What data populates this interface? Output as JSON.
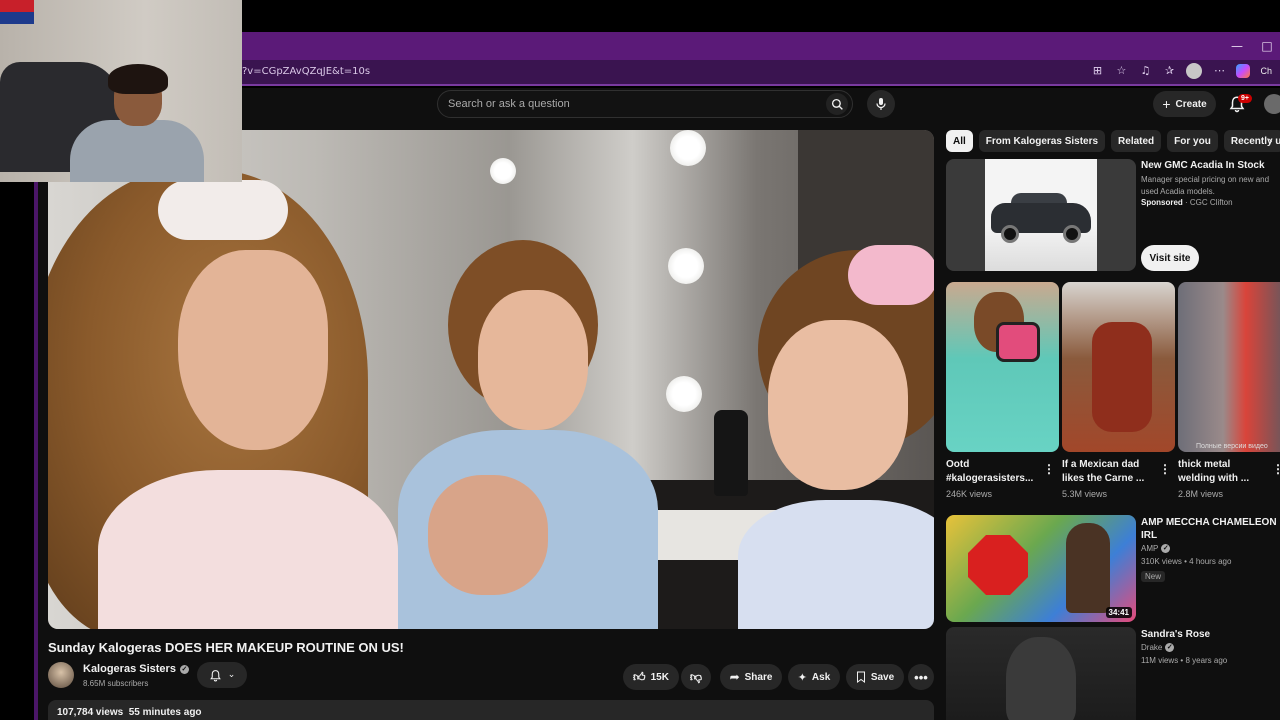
{
  "browser": {
    "url": "?v=CGpZAvQZqJE&t=10s",
    "minimize_glyph": "—",
    "maximize_glyph": "□",
    "copilot_label": "Ch"
  },
  "header": {
    "search_placeholder": "Search or ask a question",
    "create_label": "Create",
    "notification_badge": "9+"
  },
  "video": {
    "title": "Sunday Kalogeras DOES HER MAKEUP ROUTINE ON US!",
    "channel": "Kalogeras Sisters",
    "subscribers": "8.65M subscribers",
    "likes": "15K",
    "share_label": "Share",
    "ask_label": "Ask",
    "save_label": "Save",
    "views": "107,784 views",
    "posted": "55 minutes ago"
  },
  "chips": [
    "All",
    "From Kalogeras Sisters",
    "Related",
    "For you",
    "Recently u"
  ],
  "ad": {
    "title": "New GMC Acadia In Stock",
    "description": "Manager special pricing on new and used Acadia models.",
    "sponsored_label": "Sponsored",
    "advertiser": "· CGC Clifton",
    "visit_label": "Visit site"
  },
  "shorts": [
    {
      "title": "Ootd #kalogerasisters...",
      "views": "246K views"
    },
    {
      "title": "If a Mexican dad likes the Carne ...",
      "views": "5.3M views"
    },
    {
      "title": "thick metal welding with ...",
      "views": "2.8M views",
      "caption": "Полные версии видео"
    }
  ],
  "recommended": [
    {
      "title": "AMP MECCHA CHAMELEON IRL",
      "channel": "AMP",
      "meta": "310K views • 4 hours ago",
      "duration": "34:41",
      "badge": "New"
    },
    {
      "title": "Sandra's Rose",
      "channel": "Drake",
      "meta": "11M views • 8 years ago"
    }
  ],
  "colors": {
    "accent_purple": "#5b1a78",
    "yt_background": "#0f0f0f",
    "pill": "#272727"
  }
}
